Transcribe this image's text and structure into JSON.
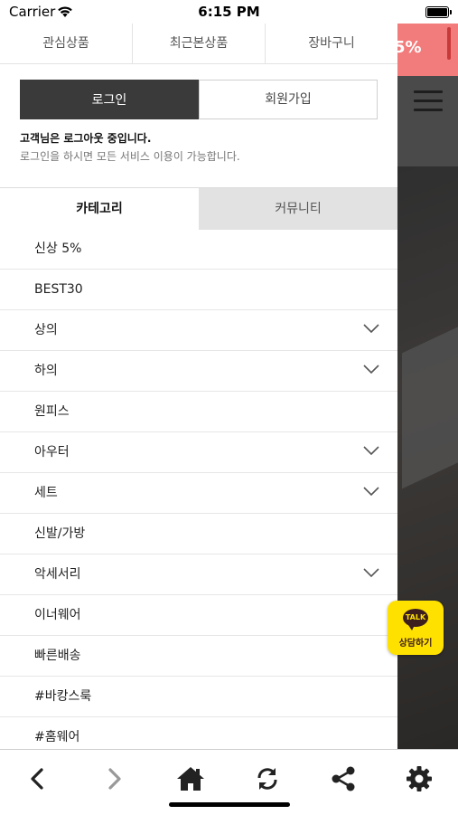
{
  "status_bar": {
    "carrier": "Carrier",
    "time": "6:15 PM"
  },
  "background": {
    "banner_text": "5%",
    "banner_color": "#f27b7b"
  },
  "top_tabs": [
    {
      "label": "관심상품"
    },
    {
      "label": "최근본상품"
    },
    {
      "label": "장바구니"
    }
  ],
  "auth": {
    "login_label": "로그인",
    "join_label": "회원가입",
    "message_title": "고객님은 로그아웃 중입니다.",
    "message_sub": "로그인을 하시면 모든 서비스 이용이 가능합니다."
  },
  "category_tabs": [
    {
      "label": "카테고리",
      "active": true
    },
    {
      "label": "커뮤니티",
      "active": false
    }
  ],
  "menu": [
    {
      "label": "신상 5%",
      "has_children": false
    },
    {
      "label": "BEST30",
      "has_children": false
    },
    {
      "label": "상의",
      "has_children": true
    },
    {
      "label": "하의",
      "has_children": true
    },
    {
      "label": "원피스",
      "has_children": false
    },
    {
      "label": "아우터",
      "has_children": true
    },
    {
      "label": "세트",
      "has_children": true
    },
    {
      "label": "신발/가방",
      "has_children": false
    },
    {
      "label": "악세서리",
      "has_children": true
    },
    {
      "label": "이너웨어",
      "has_children": false
    },
    {
      "label": "빠른배송",
      "has_children": false
    },
    {
      "label": "#바캉스룩",
      "has_children": false
    },
    {
      "label": "#홈웨어",
      "has_children": false
    }
  ],
  "talk_button": {
    "icon_text": "TALK",
    "label": "상담하기",
    "color": "#ffe100"
  },
  "toolbar": {
    "items": [
      {
        "icon": "back-icon"
      },
      {
        "icon": "forward-icon"
      },
      {
        "icon": "home-icon"
      },
      {
        "icon": "refresh-icon"
      },
      {
        "icon": "share-icon"
      },
      {
        "icon": "settings-icon"
      }
    ]
  }
}
